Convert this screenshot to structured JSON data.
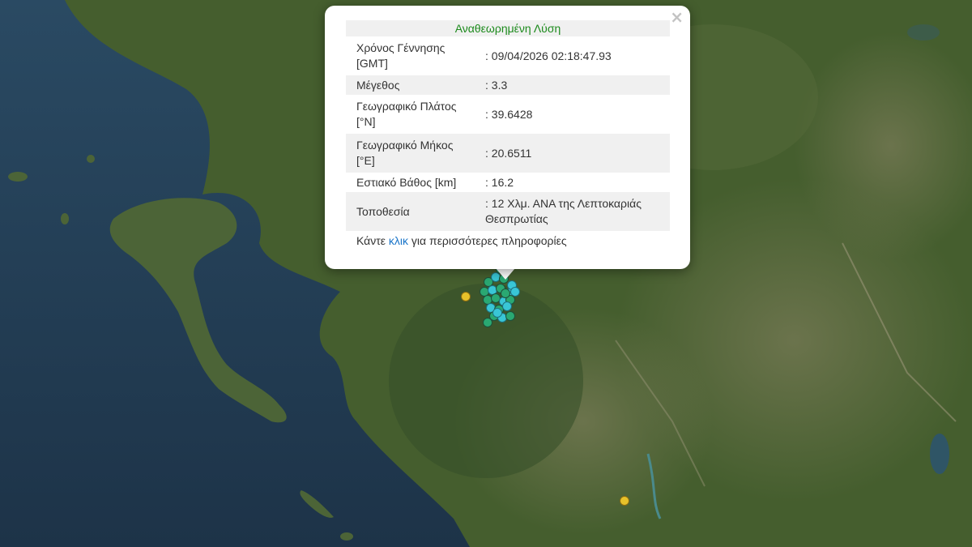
{
  "popup": {
    "title": "Αναθεωρημένη Λύση",
    "rows": [
      {
        "label": "Χρόνος Γέννησης [GMT]",
        "value": ": 09/04/2026 02:18:47.93"
      },
      {
        "label": "Μέγεθος",
        "value": ": 3.3"
      },
      {
        "label": "Γεωγραφικό Πλάτος [°N]",
        "value": ": 39.6428"
      },
      {
        "label": "Γεωγραφικό Μήκος [°E]",
        "value": ": 20.6511"
      },
      {
        "label": "Εστιακό Βάθος [km]",
        "value": ": 16.2"
      },
      {
        "label": "Τοποθεσία",
        "value": ": 12 Χλμ. ΑΝΑ της Λεπτοκαριάς Θεσπρωτίας"
      }
    ],
    "more_prefix": "Κάντε ",
    "more_link": "κλικ",
    "more_suffix": " για περισσότερες πληροφορίες",
    "close_symbol": "×"
  },
  "markers": {
    "colors": {
      "green": "#2aa872",
      "cyan": "#39c6d6",
      "yellow": "#e7c12a"
    }
  },
  "colors": {
    "sea": "#223a52",
    "land": "#3f5a2b",
    "title_green": "#1c8a1c",
    "link_blue": "#1a75c9"
  }
}
